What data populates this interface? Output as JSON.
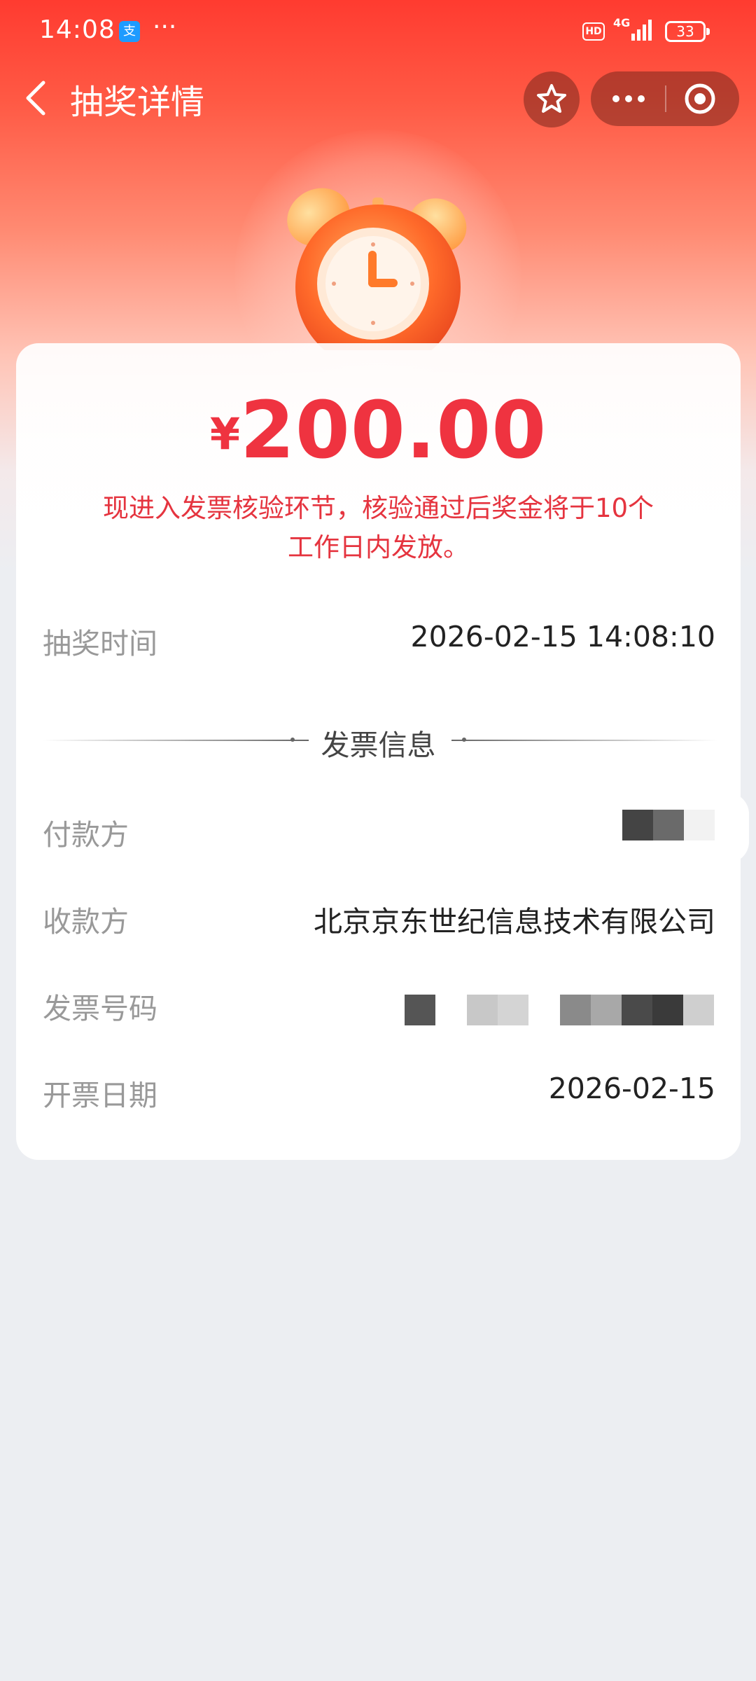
{
  "status_bar": {
    "time": "14:08",
    "app_icon": "支",
    "more": "···",
    "hd_badge": "HD",
    "network": "4G",
    "battery": "33"
  },
  "nav": {
    "title": "抽奖详情",
    "back_icon": "chevron-left-icon",
    "favorite_icon": "star-icon",
    "more_icon": "more-dots-icon",
    "close_icon": "target-circle-icon"
  },
  "prize": {
    "currency_symbol": "¥",
    "amount": "200.00",
    "notice": "现进入发票核验环节，核验通过后奖金将于10个工作日内发放。"
  },
  "draw_time": {
    "label": "抽奖时间",
    "value": "2026-02-15 14:08:10"
  },
  "invoice": {
    "section_title": "发票信息",
    "payer_label": "付款方",
    "payee_label": "收款方",
    "payee_value": "北京京东世纪信息技术有限公司",
    "invoice_no_label": "发票号码",
    "issue_date_label": "开票日期",
    "issue_date_value": "2026-02-15"
  },
  "colors": {
    "accent_red": "#ef3340",
    "header_red": "#ff3b30",
    "background": "#eceef2"
  }
}
